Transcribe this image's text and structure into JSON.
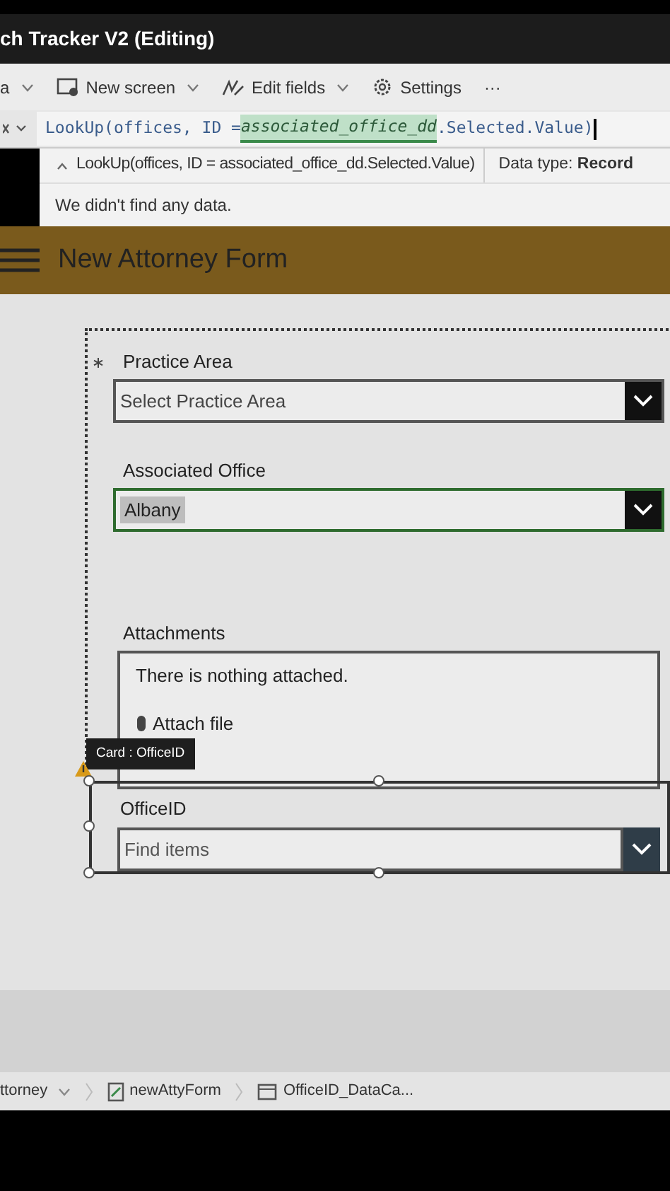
{
  "window": {
    "title": "ch Tracker V2 (Editing)"
  },
  "toolbar": [
    {
      "kind": "menu",
      "label": "a",
      "dropdown": true
    },
    {
      "kind": "new_screen",
      "label": "New screen",
      "dropdown": true
    },
    {
      "kind": "edit_fields",
      "label": "Edit fields",
      "dropdown": true
    },
    {
      "kind": "settings",
      "label": "Settings",
      "dropdown": false
    },
    {
      "kind": "more",
      "label": "···",
      "dropdown": false
    }
  ],
  "formula_bar": {
    "parts": [
      {
        "text": "LookUp(offices, ID = ",
        "highlighted": false
      },
      {
        "text": "associated_office_dd",
        "highlighted": true
      },
      {
        "text": ".Selected.Value)",
        "highlighted": false
      }
    ]
  },
  "formula_preview": {
    "expression": "LookUp(offices, ID = associated_office_dd.Selected.Value)",
    "data_type": "Data type: **Record**",
    "message": "We didn't find any data."
  },
  "header": {
    "title": "New Attorney Form"
  },
  "form": {
    "fields": [
      {
        "kind": "dropdown",
        "label": "Practice Area",
        "required": true,
        "placeholder": "Select Practice Area",
        "focused": false
      },
      {
        "kind": "dropdown",
        "label": "Associated Office",
        "required": false,
        "value": "Albany",
        "focused": true
      },
      {
        "kind": "attachments",
        "label": "Attachments",
        "required": false,
        "empty_message": "There is nothing attached.",
        "action": "Attach file"
      }
    ]
  },
  "selected_card": {
    "tooltip": "Card : OfficeID",
    "warning": true,
    "label": "OfficeID",
    "placeholder": "Find items"
  },
  "breadcrumb": [
    {
      "kind": "screen",
      "label": "ttorney",
      "dropdown": true
    },
    {
      "kind": "form",
      "label": "newAttyForm",
      "dropdown": false
    },
    {
      "kind": "card",
      "label": "OfficeID_DataCa...",
      "dropdown": false
    }
  ]
}
